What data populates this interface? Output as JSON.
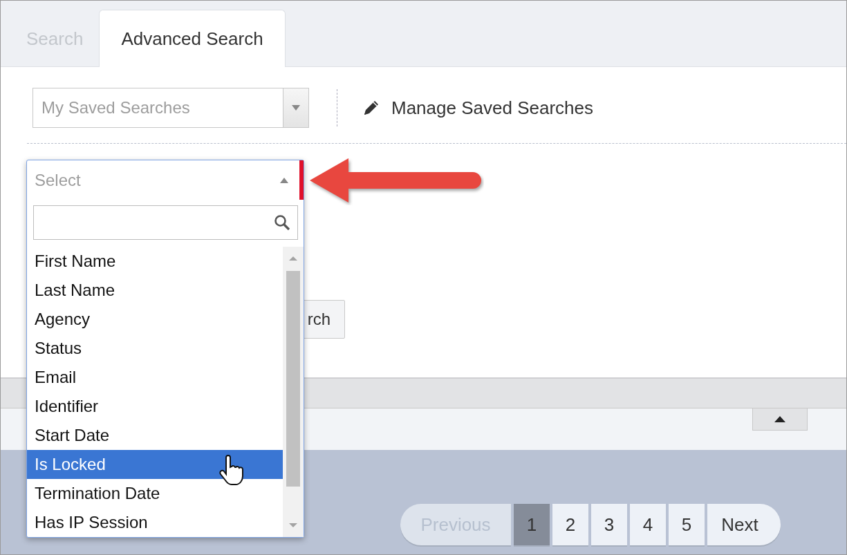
{
  "tabs": [
    {
      "label": "Search",
      "selected": false
    },
    {
      "label": "Advanced Search",
      "selected": true
    }
  ],
  "saved_searches": {
    "placeholder": "My Saved Searches"
  },
  "manage_link": "Manage Saved Searches",
  "search_button": "rch",
  "field_select": {
    "placeholder": "Select",
    "expanded": true,
    "options": [
      {
        "label": "First Name",
        "selected": false
      },
      {
        "label": "Last Name",
        "selected": false
      },
      {
        "label": "Agency",
        "selected": false
      },
      {
        "label": "Status",
        "selected": false
      },
      {
        "label": "Email",
        "selected": false
      },
      {
        "label": "Identifier",
        "selected": false
      },
      {
        "label": "Start Date",
        "selected": false
      },
      {
        "label": "Is Locked",
        "selected": true
      },
      {
        "label": "Termination Date",
        "selected": false
      },
      {
        "label": "Has IP Session",
        "selected": false
      }
    ]
  },
  "pagination": [
    {
      "kind": "prev",
      "label": "Previous",
      "disabled": true
    },
    {
      "kind": "page",
      "label": "1",
      "selected": true
    },
    {
      "kind": "page",
      "label": "2",
      "selected": false
    },
    {
      "kind": "page",
      "label": "3",
      "selected": false
    },
    {
      "kind": "page",
      "label": "4",
      "selected": false
    },
    {
      "kind": "page",
      "label": "5",
      "selected": false
    },
    {
      "kind": "next",
      "label": "Next",
      "disabled": false
    }
  ]
}
